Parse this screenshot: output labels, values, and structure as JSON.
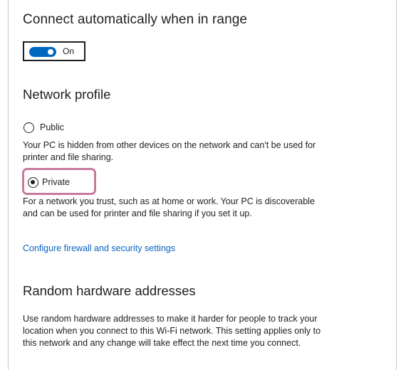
{
  "connect_auto": {
    "heading": "Connect automatically when in range",
    "toggle_state": "On",
    "toggle_on": true
  },
  "network_profile": {
    "heading": "Network profile",
    "options": [
      {
        "label": "Public",
        "selected": false,
        "description": "Your PC is hidden from other devices on the network and can't be used for printer and file sharing."
      },
      {
        "label": "Private",
        "selected": true,
        "description": "For a network you trust, such as at home or work. Your PC is discoverable and can be used for printer and file sharing if you set it up."
      }
    ],
    "firewall_link": "Configure firewall and security settings"
  },
  "random_hw": {
    "heading": "Random hardware addresses",
    "description": "Use random hardware addresses to make it harder for people to track your location when you connect to this Wi-Fi network. This setting applies only to this network and any change will take effect the next time you connect."
  },
  "colors": {
    "accent": "#0067c0",
    "link": "#0b64c0",
    "highlight": "#c9799e"
  }
}
